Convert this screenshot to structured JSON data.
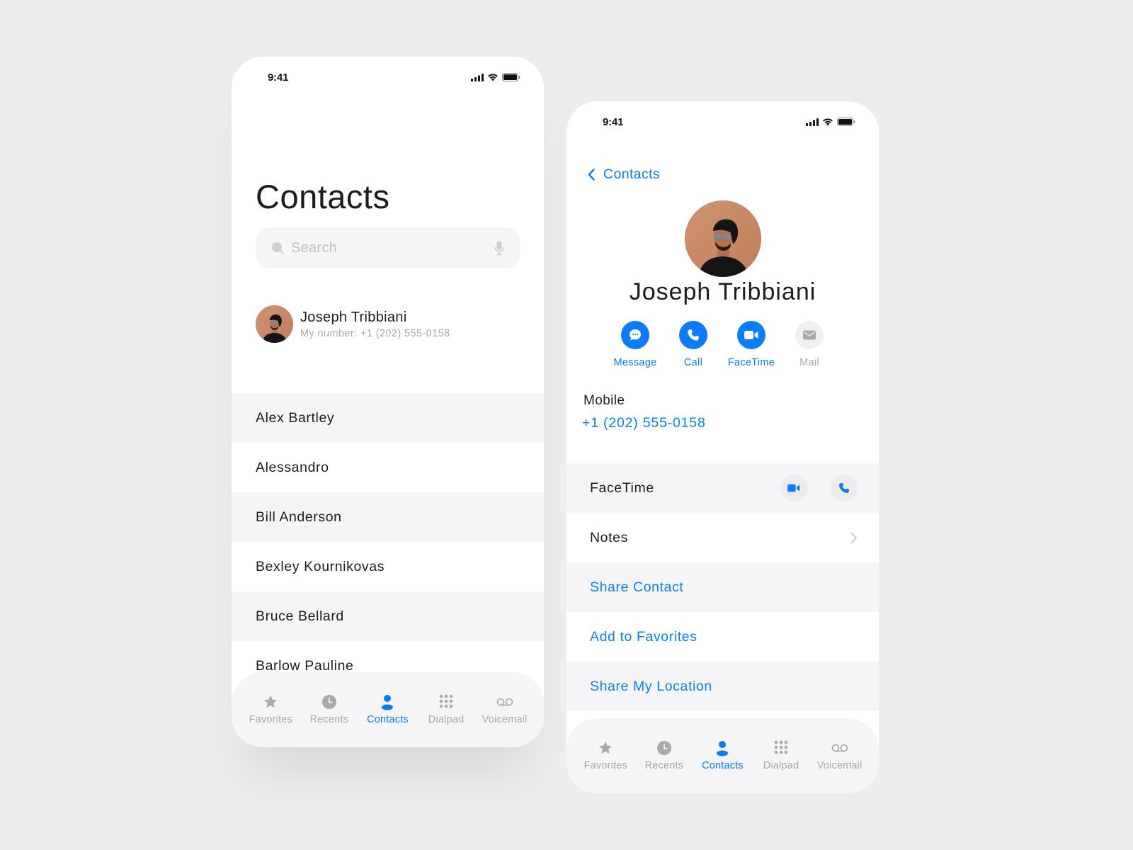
{
  "theme": {
    "accent": "#0a7cff",
    "muted": "#a9a9ad",
    "row_alt": "#f5f5f7",
    "background": "#ededed"
  },
  "left_phone": {
    "status": {
      "time": "9:41"
    },
    "title": "Contacts",
    "search": {
      "placeholder": "Search",
      "value": "",
      "icons": [
        "search-icon",
        "microphone-icon"
      ]
    },
    "my_card": {
      "name": "Joseph Tribbiani",
      "subtitle": "My number: +1 (202) 555-0158"
    },
    "contacts": [
      {
        "name": "Alex Bartley"
      },
      {
        "name": "Alessandro"
      },
      {
        "name": "Bill Anderson"
      },
      {
        "name": "Bexley Kournikovas"
      },
      {
        "name": "Bruce Bellard"
      },
      {
        "name": "Barlow Pauline"
      }
    ],
    "tabs": [
      {
        "label": "Favorites",
        "icon": "star-icon",
        "active": false
      },
      {
        "label": "Recents",
        "icon": "clock-icon",
        "active": false
      },
      {
        "label": "Contacts",
        "icon": "person-icon",
        "active": true
      },
      {
        "label": "Dialpad",
        "icon": "dialpad-icon",
        "active": false
      },
      {
        "label": "Voicemail",
        "icon": "voicemail-icon",
        "active": false
      }
    ]
  },
  "right_phone": {
    "status": {
      "time": "9:41"
    },
    "back_label": "Contacts",
    "name": "Joseph Tribbiani",
    "actions": [
      {
        "label": "Message",
        "icon": "message-icon",
        "enabled": true
      },
      {
        "label": "Call",
        "icon": "phone-icon",
        "enabled": true
      },
      {
        "label": "FaceTime",
        "icon": "video-icon",
        "enabled": true
      },
      {
        "label": "Mail",
        "icon": "mail-icon",
        "enabled": false
      }
    ],
    "phone_field": {
      "label": "Mobile",
      "value": "+1 (202) 555-0158"
    },
    "rows": [
      {
        "label": "FaceTime",
        "type": "facetime"
      },
      {
        "label": "Notes",
        "type": "chevron"
      },
      {
        "label": "Share Contact",
        "type": "link"
      },
      {
        "label": "Add to Favorites",
        "type": "link"
      },
      {
        "label": "Share My Location",
        "type": "link"
      }
    ],
    "tabs": [
      {
        "label": "Favorites",
        "icon": "star-icon",
        "active": false
      },
      {
        "label": "Recents",
        "icon": "clock-icon",
        "active": false
      },
      {
        "label": "Contacts",
        "icon": "person-icon",
        "active": true
      },
      {
        "label": "Dialpad",
        "icon": "dialpad-icon",
        "active": false
      },
      {
        "label": "Voicemail",
        "icon": "voicemail-icon",
        "active": false
      }
    ]
  }
}
